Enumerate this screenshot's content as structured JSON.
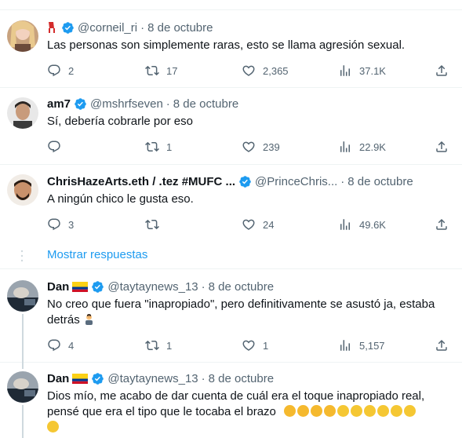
{
  "tweets": [
    {
      "name": "",
      "handle": "@corneil_ri",
      "date": "8 de octubre",
      "text": "Las personas son simplemente raras, esto se llama agresión sexual.",
      "replies": "2",
      "retweets": "17",
      "likes": "2,365",
      "views": "37.1K"
    },
    {
      "name": "am7",
      "handle": "@mshrfseven",
      "date": "8 de octubre",
      "text": "Sí, debería cobrarle por eso",
      "replies": "",
      "retweets": "1",
      "likes": "239",
      "views": "22.9K"
    },
    {
      "name": "ChrisHazeArts.eth / .tez #MUFC ...",
      "handle": "@PrinceChris...",
      "date": "8 de octubre",
      "text": "A ningún chico le gusta eso.",
      "replies": "3",
      "retweets": "",
      "likes": "24",
      "views": "49.6K"
    },
    {
      "name": "Dan",
      "handle": "@taytaynews_13",
      "date": "8 de octubre",
      "text_line1": "No creo que fuera \"inapropiado\", pero definitivamente se asustó ja, estaba",
      "text_line2": "detrás",
      "replies": "4",
      "retweets": "1",
      "likes": "1",
      "views": "5,157"
    },
    {
      "name": "Dan",
      "handle": "@taytaynews_13",
      "date": "8 de octubre",
      "text_line1": "Dios mío, me acabo de dar cuenta de cuál era el toque inapropiado real,",
      "text_line2": "pensé que era el tipo que le tocaba el brazo"
    }
  ],
  "show_replies": "Mostrar respuestas",
  "colors": {
    "accent": "#1d9bf0",
    "muted": "#536471",
    "text": "#0f1419"
  },
  "icons": [
    "reply-icon",
    "retweet-icon",
    "like-icon",
    "views-icon",
    "share-icon",
    "verified-icon"
  ]
}
